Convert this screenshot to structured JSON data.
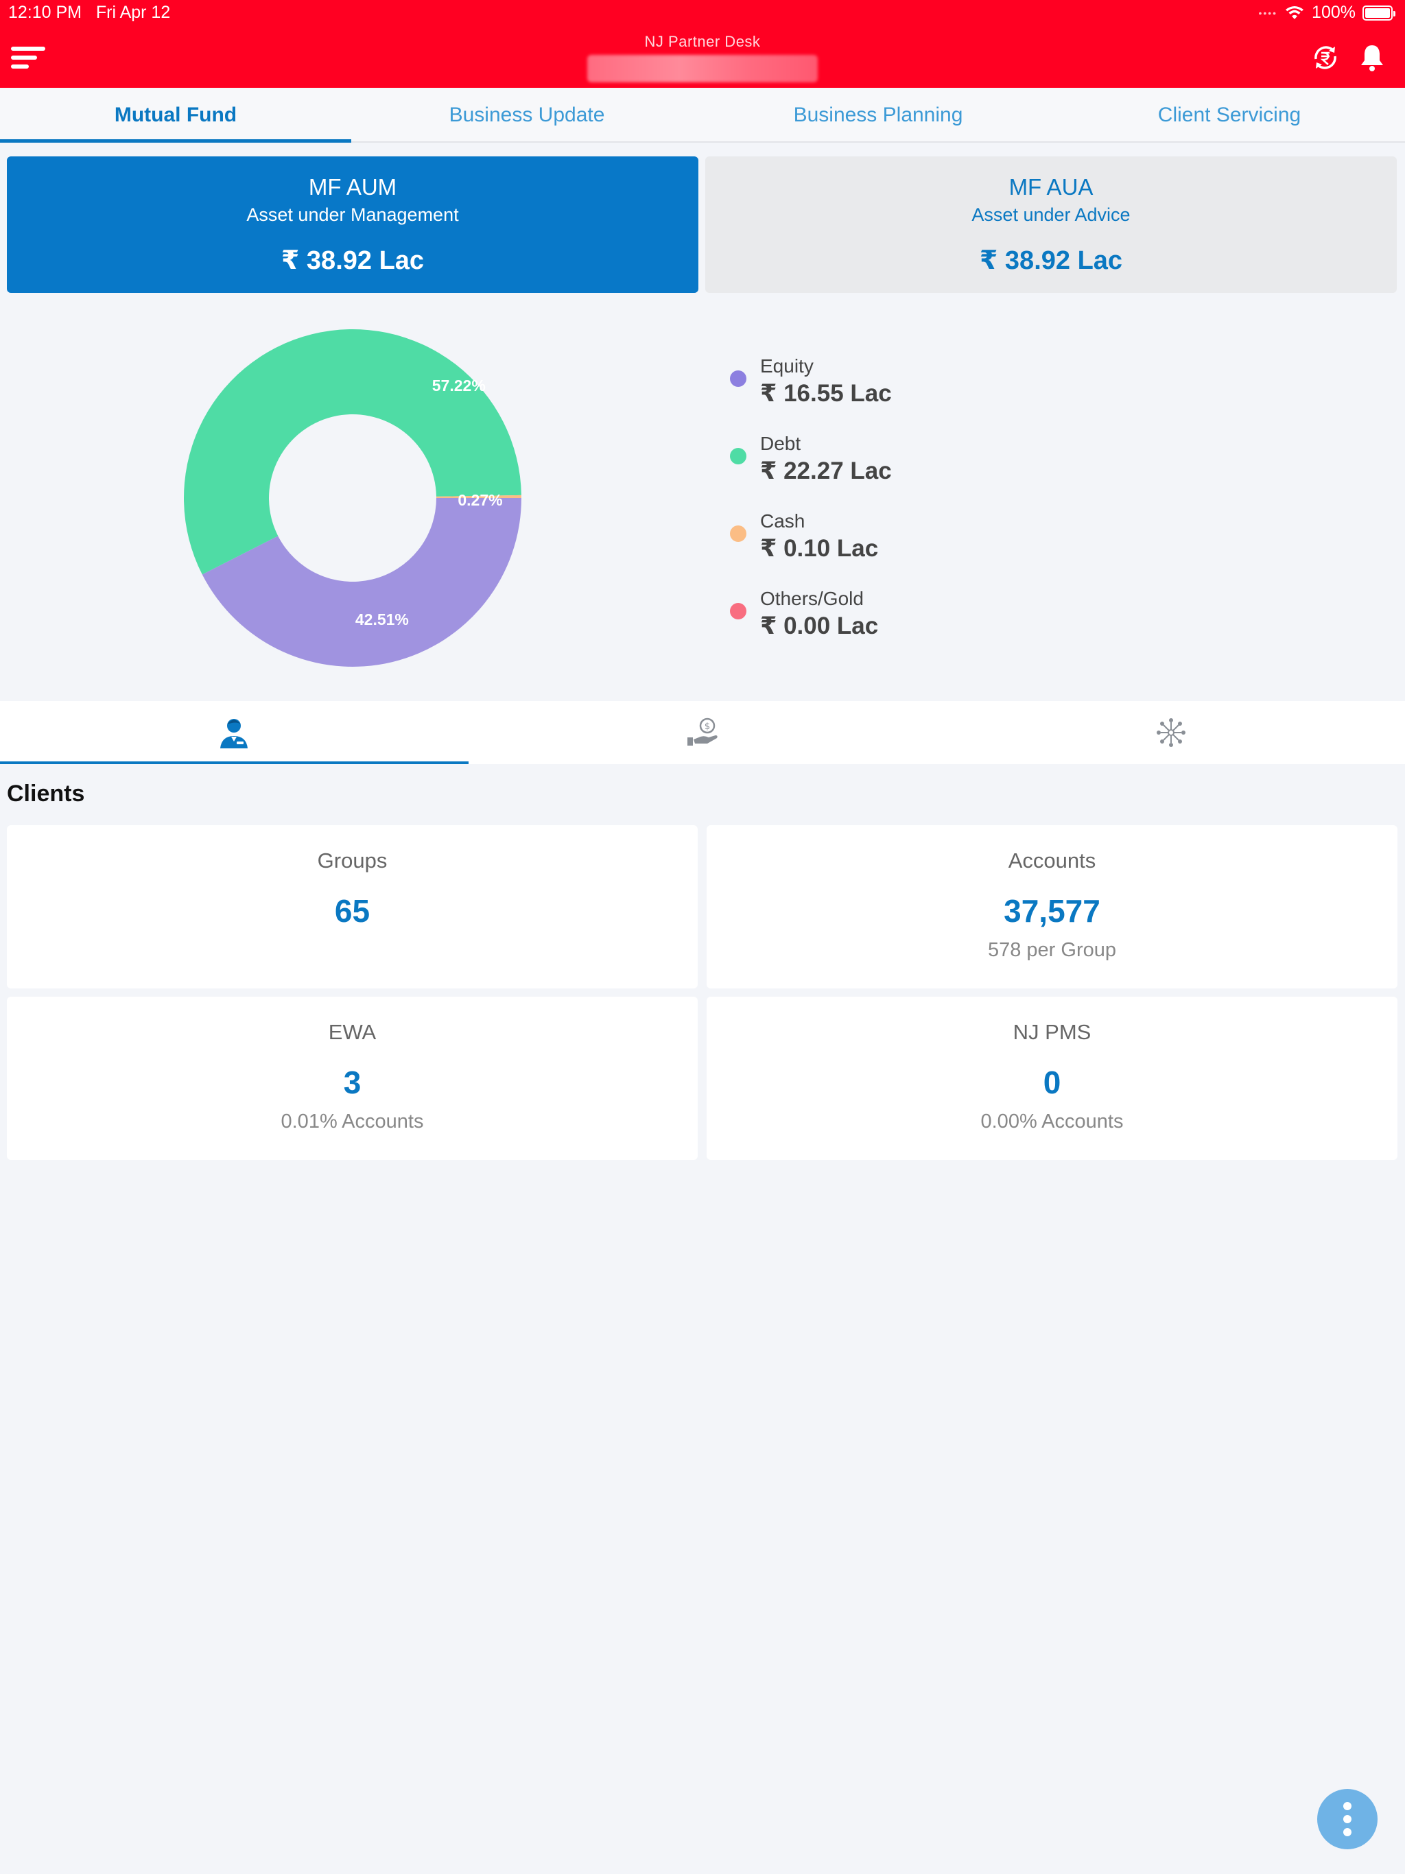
{
  "status_bar": {
    "time": "12:10 PM",
    "date": "Fri Apr 12",
    "battery": "100%",
    "icons": [
      "wifi-icon",
      "battery-icon"
    ]
  },
  "header": {
    "app_title": "NJ Partner Desk",
    "icons": [
      "menu-icon",
      "rupee-sync-icon",
      "bell-icon"
    ]
  },
  "tabs": [
    {
      "label": "Mutual Fund",
      "active": true
    },
    {
      "label": "Business Update",
      "active": false
    },
    {
      "label": "Business Planning",
      "active": false
    },
    {
      "label": "Client Servicing",
      "active": false
    }
  ],
  "aum_cards": {
    "aum": {
      "title": "MF AUM",
      "subtitle": "Asset under Management",
      "value": "₹ 38.92 Lac"
    },
    "aua": {
      "title": "MF AUA",
      "subtitle": "Asset under Advice",
      "value": "₹ 38.92 Lac"
    }
  },
  "chart_data": {
    "type": "pie",
    "donut": true,
    "labels": [
      "Equity",
      "Debt",
      "Cash",
      "Others/Gold"
    ],
    "values": [
      42.51,
      57.22,
      0.27,
      0.0
    ],
    "value_labels": [
      "42.51%",
      "57.22%",
      "0.27%",
      ""
    ],
    "colors": [
      "#a093e0",
      "#4fdca5",
      "#fbbd85",
      "#f86d80"
    ],
    "legend_placement": "right"
  },
  "legend": [
    {
      "label": "Equity",
      "value": "₹ 16.55 Lac",
      "color": "#8c7fe0"
    },
    {
      "label": "Debt",
      "value": "₹ 22.27 Lac",
      "color": "#4fdca5"
    },
    {
      "label": "Cash",
      "value": "₹ 0.10 Lac",
      "color": "#fbbd85"
    },
    {
      "label": "Others/Gold",
      "value": "₹ 0.00 Lac",
      "color": "#f86d80"
    }
  ],
  "sub_tabs": [
    {
      "icon": "client-user-icon",
      "active": true
    },
    {
      "icon": "money-hand-icon",
      "active": false
    },
    {
      "icon": "network-hub-icon",
      "active": false
    }
  ],
  "clients": {
    "title": "Clients",
    "groups": {
      "label": "Groups",
      "value": "65",
      "sub": ""
    },
    "accounts": {
      "label": "Accounts",
      "value": "37,577",
      "sub": "578 per Group"
    },
    "ewa": {
      "label": "EWA",
      "value": "3",
      "sub": "0.01% Accounts"
    },
    "pms": {
      "label": "NJ PMS",
      "value": "0",
      "sub": "0.00% Accounts"
    }
  },
  "fab": {
    "icon": "more-vertical-icon"
  }
}
